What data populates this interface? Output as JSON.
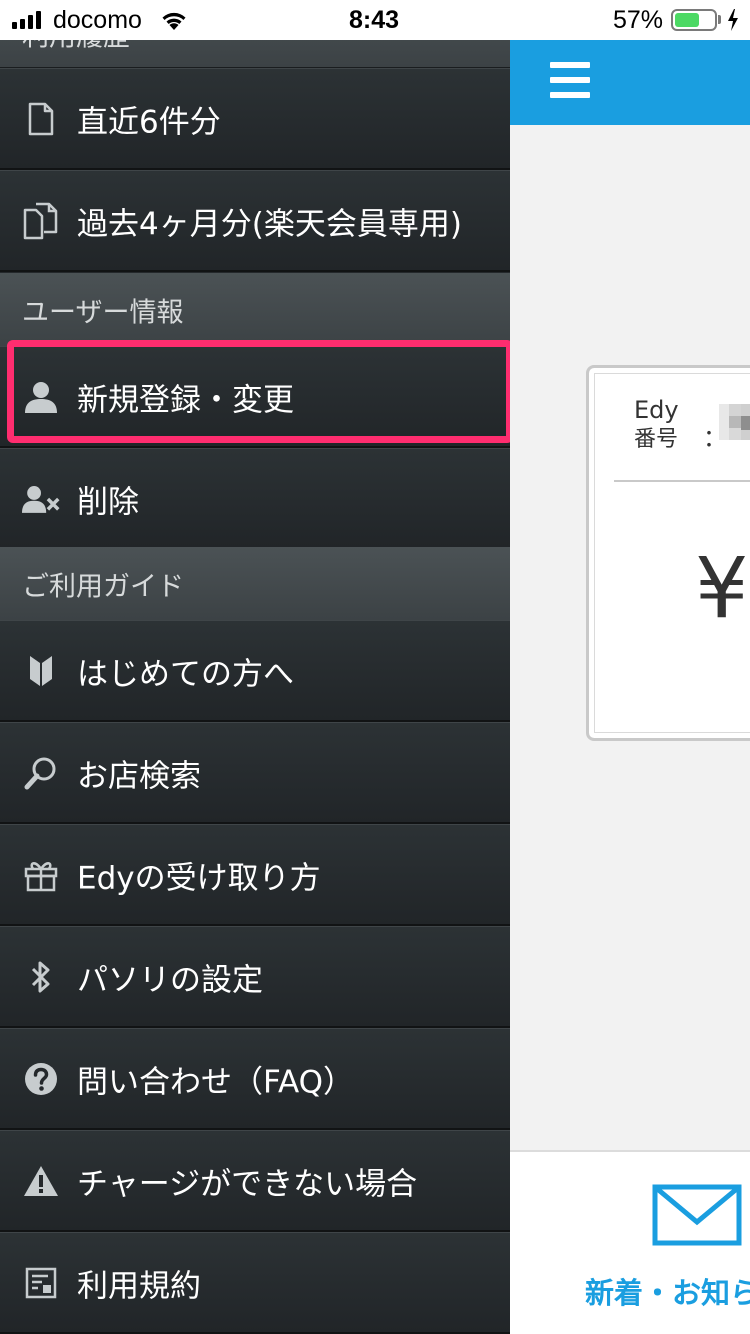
{
  "status_bar": {
    "carrier": "docomo",
    "time": "8:43",
    "battery_percent": "57%",
    "battery_level": 0.57,
    "battery_color": "#4cd964"
  },
  "drawer": {
    "highlight_color": "#ff2d6f",
    "top_section_label": "利用履歴",
    "usage_items": [
      {
        "label": "直近6件分",
        "icon": "document-icon"
      },
      {
        "label": "過去4ヶ月分(楽天会員専用)",
        "icon": "documents-icon"
      }
    ],
    "user_section_label": "ユーザー情報",
    "user_items": [
      {
        "label": "新規登録・変更",
        "icon": "user-icon",
        "highlighted": true
      },
      {
        "label": "削除",
        "icon": "user-remove-icon"
      }
    ],
    "guide_section_label": "ご利用ガイド",
    "guide_items": [
      {
        "label": "はじめての方へ",
        "icon": "beginner-mark-icon"
      },
      {
        "label": "お店検索",
        "icon": "search-icon"
      },
      {
        "label": "Edyの受け取り方",
        "icon": "gift-icon"
      },
      {
        "label": "パソリの設定",
        "icon": "bluetooth-icon"
      },
      {
        "label": "問い合わせ（FAQ）",
        "icon": "question-icon"
      },
      {
        "label": "チャージができない場合",
        "icon": "warning-icon"
      },
      {
        "label": "利用規約",
        "icon": "terms-icon"
      }
    ]
  },
  "main": {
    "topbar_color": "#1a9ee0",
    "card": {
      "edy_label": "Edy",
      "number_label": "番号",
      "colon": "：",
      "balance_symbol": "¥"
    },
    "bottom_nav": {
      "news_label": "新着・お知らせ"
    }
  }
}
